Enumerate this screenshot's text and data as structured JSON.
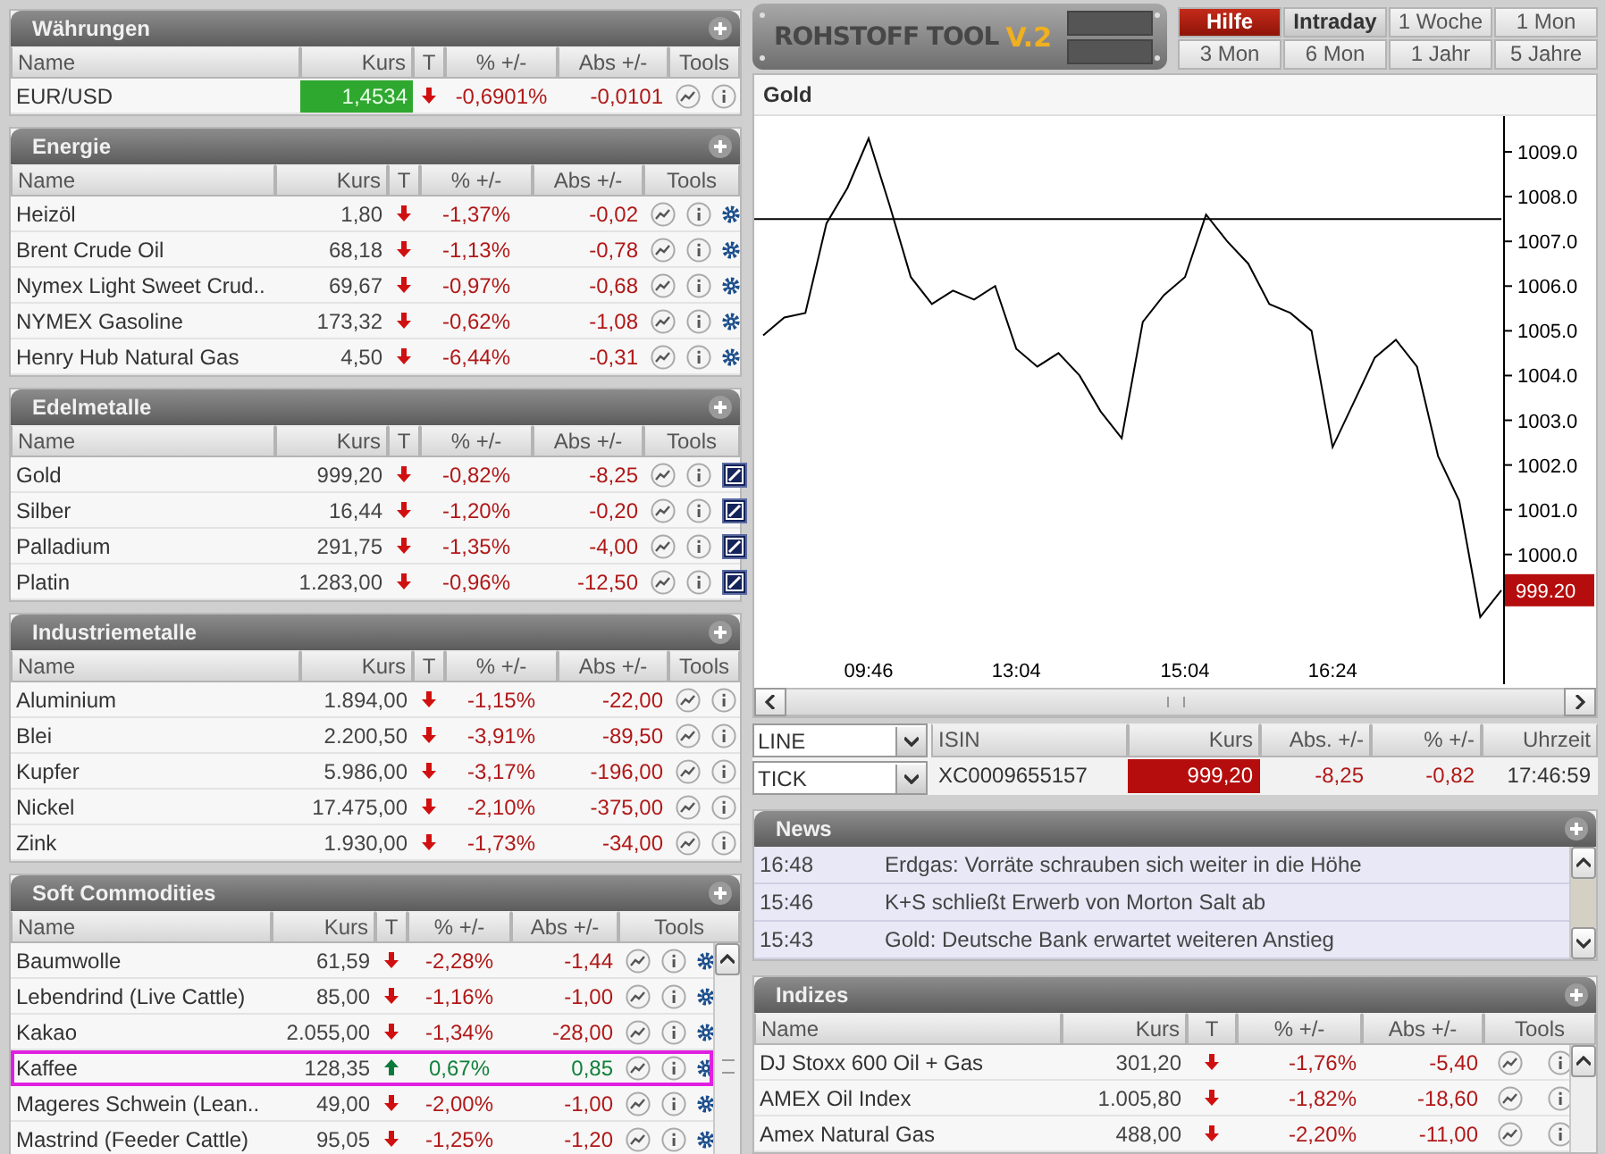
{
  "panels": [
    {
      "title": "Währungen",
      "kind": "plain",
      "columns": [
        "Name",
        "Kurs",
        "T",
        "% +/-",
        "Abs +/-",
        "Tools"
      ],
      "rows": [
        {
          "name": "EUR/USD",
          "kurs": "1,4534",
          "flash": true,
          "rising": false,
          "pct": "-0,6901%",
          "abs": "-0,0101",
          "selected": false
        }
      ]
    },
    {
      "title": "Energie",
      "kind": "gear",
      "columns": [
        "Name",
        "Kurs",
        "T",
        "% +/-",
        "Abs +/-",
        "Tools"
      ],
      "rows": [
        {
          "name": "Heizöl",
          "kurs": "1,80",
          "rising": false,
          "pct": "-1,37%",
          "abs": "-0,02",
          "selected": false
        },
        {
          "name": "Brent Crude Oil",
          "kurs": "68,18",
          "rising": false,
          "pct": "-1,13%",
          "abs": "-0,78",
          "selected": false
        },
        {
          "name": "Nymex Light Sweet Crud..",
          "kurs": "69,67",
          "rising": false,
          "pct": "-0,97%",
          "abs": "-0,68",
          "selected": false
        },
        {
          "name": "NYMEX Gasoline",
          "kurs": "173,32",
          "rising": false,
          "pct": "-0,62%",
          "abs": "-1,08",
          "selected": false
        },
        {
          "name": "Henry Hub Natural Gas",
          "kurs": "4,50",
          "rising": false,
          "pct": "-6,44%",
          "abs": "-0,31",
          "selected": false
        }
      ]
    },
    {
      "title": "Edelmetalle",
      "kind": "edit",
      "columns": [
        "Name",
        "Kurs",
        "T",
        "% +/-",
        "Abs +/-",
        "Tools"
      ],
      "rows": [
        {
          "name": "Gold",
          "kurs": "999,20",
          "rising": false,
          "pct": "-0,82%",
          "abs": "-8,25",
          "selected": false
        },
        {
          "name": "Silber",
          "kurs": "16,44",
          "rising": false,
          "pct": "-1,20%",
          "abs": "-0,20",
          "selected": false
        },
        {
          "name": "Palladium",
          "kurs": "291,75",
          "rising": false,
          "pct": "-1,35%",
          "abs": "-4,00",
          "selected": false
        },
        {
          "name": "Platin",
          "kurs": "1.283,00",
          "rising": false,
          "pct": "-0,96%",
          "abs": "-12,50",
          "selected": false
        }
      ]
    },
    {
      "title": "Industriemetalle",
      "kind": "plain",
      "columns": [
        "Name",
        "Kurs",
        "T",
        "% +/-",
        "Abs +/-",
        "Tools"
      ],
      "rows": [
        {
          "name": "Aluminium",
          "kurs": "1.894,00",
          "rising": false,
          "pct": "-1,15%",
          "abs": "-22,00",
          "selected": false
        },
        {
          "name": "Blei",
          "kurs": "2.200,50",
          "rising": false,
          "pct": "-3,91%",
          "abs": "-89,50",
          "selected": false
        },
        {
          "name": "Kupfer",
          "kurs": "5.986,00",
          "rising": false,
          "pct": "-3,17%",
          "abs": "-196,00",
          "selected": false
        },
        {
          "name": "Nickel",
          "kurs": "17.475,00",
          "rising": false,
          "pct": "-2,10%",
          "abs": "-375,00",
          "selected": false
        },
        {
          "name": "Zink",
          "kurs": "1.930,00",
          "rising": false,
          "pct": "-1,73%",
          "abs": "-34,00",
          "selected": false
        }
      ]
    },
    {
      "title": "Soft Commodities",
      "kind": "gear",
      "scrollable": true,
      "columns": [
        "Name",
        "Kurs",
        "T",
        "% +/-",
        "Abs +/-",
        "Tools"
      ],
      "rows": [
        {
          "name": "Baumwolle",
          "kurs": "61,59",
          "rising": false,
          "pct": "-2,28%",
          "abs": "-1,44",
          "selected": false
        },
        {
          "name": "Lebendrind (Live Cattle)",
          "kurs": "85,00",
          "rising": false,
          "pct": "-1,16%",
          "abs": "-1,00",
          "selected": false
        },
        {
          "name": "Kakao",
          "kurs": "2.055,00",
          "rising": false,
          "pct": "-1,34%",
          "abs": "-28,00",
          "selected": false
        },
        {
          "name": "Kaffee",
          "kurs": "128,35",
          "rising": true,
          "pct": "0,67%",
          "abs": "0,85",
          "selected": true
        },
        {
          "name": "Mageres Schwein (Lean..",
          "kurs": "49,00",
          "rising": false,
          "pct": "-2,00%",
          "abs": "-1,00",
          "selected": false
        },
        {
          "name": "Mastrind (Feeder Cattle)",
          "kurs": "95,05",
          "rising": false,
          "pct": "-1,25%",
          "abs": "-1,20",
          "selected": false
        }
      ]
    }
  ],
  "logo": {
    "title": "ROHSTOFF TOOL",
    "version": "V.2"
  },
  "periods": [
    {
      "label": "Hilfe",
      "kind": "help",
      "selected": false
    },
    {
      "label": "Intraday",
      "kind": "period",
      "selected": true
    },
    {
      "label": "1 Woche",
      "kind": "period",
      "selected": false
    },
    {
      "label": "1 Mon",
      "kind": "period",
      "selected": false
    },
    {
      "label": "3 Mon",
      "kind": "period",
      "selected": false
    },
    {
      "label": "6 Mon",
      "kind": "period",
      "selected": false
    },
    {
      "label": "1 Jahr",
      "kind": "period",
      "selected": false
    },
    {
      "label": "5 Jahre",
      "kind": "period",
      "selected": false
    }
  ],
  "chart": {
    "title": "Gold",
    "chart_data": {
      "type": "line",
      "categories": [
        null,
        null,
        null,
        null,
        null,
        "09:46",
        null,
        null,
        null,
        null,
        null,
        null,
        "13:04",
        null,
        null,
        null,
        null,
        null,
        null,
        null,
        "15:04",
        null,
        null,
        null,
        null,
        null,
        null,
        "16:24",
        null,
        null,
        null,
        null,
        null,
        null,
        null,
        null
      ],
      "series": [
        {
          "color": "#000000",
          "values": [
            1004.9,
            1005.3,
            1005.4,
            1007.4,
            1008.2,
            1009.3,
            1007.8,
            1006.2,
            1005.6,
            1005.9,
            1005.7,
            1006.0,
            1004.6,
            1004.2,
            1004.5,
            1004.0,
            1003.2,
            1002.6,
            1005.2,
            1005.8,
            1006.2,
            1007.6,
            1007.0,
            1006.5,
            1005.6,
            1005.4,
            1005.0,
            1002.4,
            1003.4,
            1004.4,
            1004.8,
            1004.2,
            1002.2,
            1001.2,
            998.6,
            999.2
          ]
        }
      ],
      "ylim": [
        997.1,
        1009.8
      ],
      "yticks": [
        {
          "value": 1000,
          "label": "1000.0"
        },
        {
          "value": 1001,
          "label": "1001.0"
        },
        {
          "value": 1002,
          "label": "1002.0"
        },
        {
          "value": 1003,
          "label": "1003.0"
        },
        {
          "value": 1004,
          "label": "1004.0"
        },
        {
          "value": 1005,
          "label": "1005.0"
        },
        {
          "value": 1006,
          "label": "1006.0"
        },
        {
          "value": 1007,
          "label": "1007.0"
        },
        {
          "value": 1008,
          "label": "1008.0"
        },
        {
          "value": 1009,
          "label": "1009.0"
        }
      ],
      "ref_lines": [
        {
          "axis": "y",
          "value": 1007.5
        }
      ],
      "annotations": [
        "999.20"
      ]
    }
  },
  "selects": [
    {
      "value": "LINE"
    },
    {
      "value": "TICK"
    }
  ],
  "quote": {
    "columns": [
      "ISIN",
      "Kurs",
      "Abs. +/-",
      "% +/-",
      "Uhrzeit"
    ],
    "values": [
      "XC0009655157",
      "999,20",
      "-8,25",
      "-0,82",
      "17:46:59"
    ],
    "flash": true
  },
  "news": {
    "title": "News",
    "items": [
      {
        "time": "16:48",
        "headline": "Erdgas: Vorräte schrauben sich weiter in die Höhe"
      },
      {
        "time": "15:46",
        "headline": "K+S schließt Erwerb von Morton Salt ab"
      },
      {
        "time": "15:43",
        "headline": "Gold: Deutsche Bank erwartet weiteren Anstieg"
      }
    ]
  },
  "indizes": {
    "title": "Indizes",
    "scrollable": true,
    "columns": [
      "Name",
      "Kurs",
      "T",
      "% +/-",
      "Abs +/-",
      "Tools"
    ],
    "rows": [
      {
        "name": "DJ Stoxx 600 Oil + Gas",
        "kurs": "301,20",
        "rising": false,
        "pct": "-1,76%",
        "abs": "-5,40",
        "selected": false
      },
      {
        "name": "AMEX Oil Index",
        "kurs": "1.005,80",
        "rising": false,
        "pct": "-1,82%",
        "abs": "-18,60",
        "selected": false
      },
      {
        "name": "Amex Natural Gas",
        "kurs": "488,00",
        "rising": false,
        "pct": "-2,20%",
        "abs": "-11,00",
        "selected": false
      }
    ]
  }
}
